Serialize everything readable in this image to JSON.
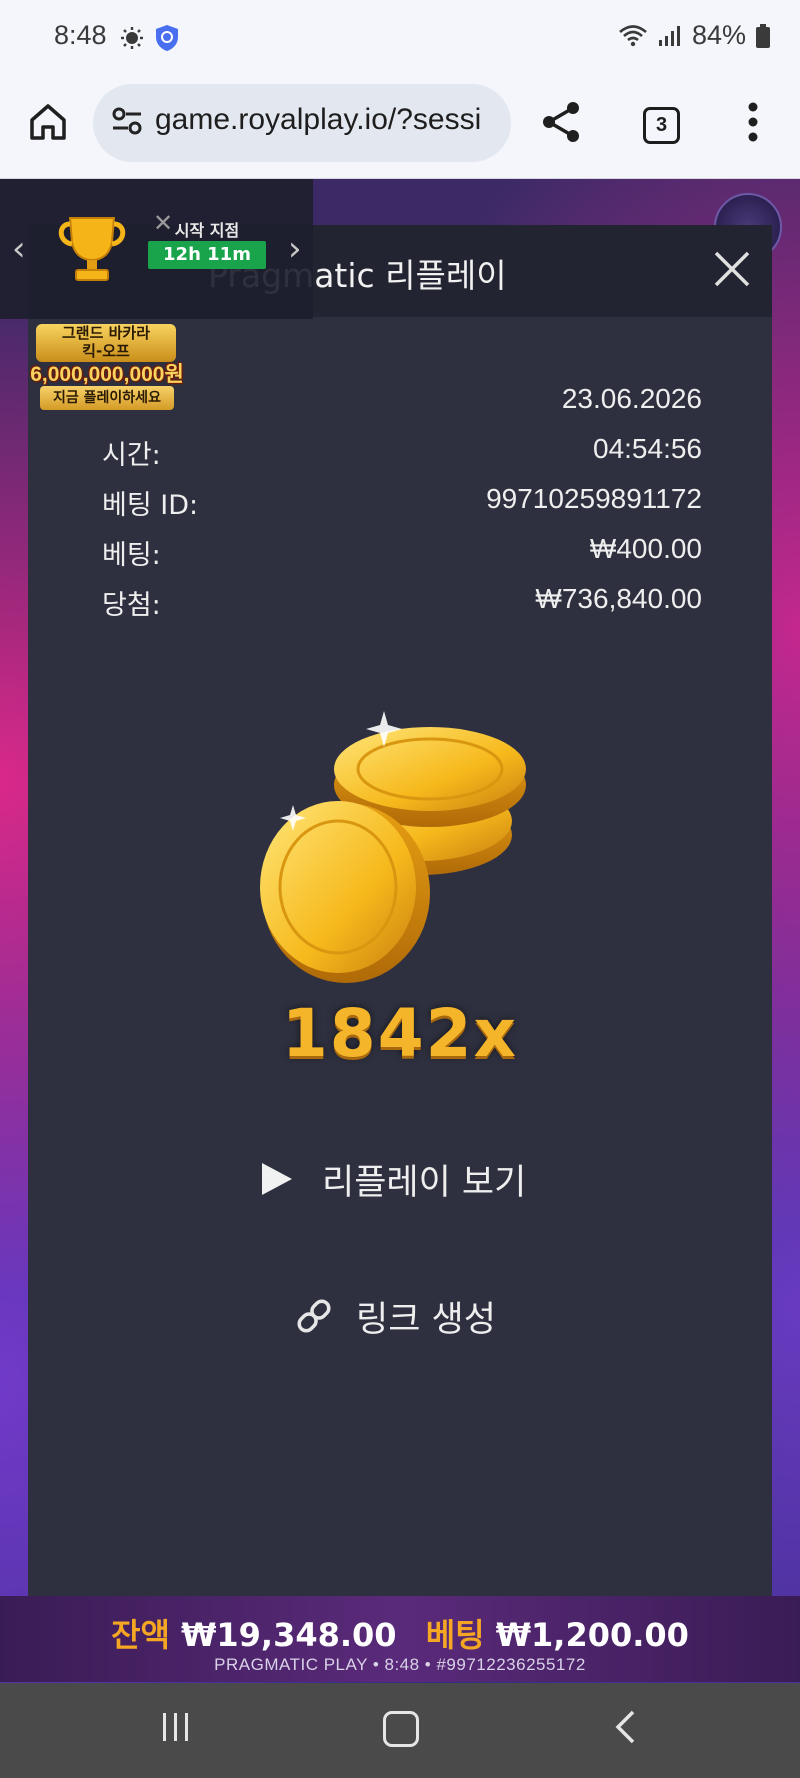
{
  "status_bar": {
    "time": "8:48",
    "battery": "84%"
  },
  "browser": {
    "url": "game.royalplay.io/?sessi",
    "tab_count": "3"
  },
  "promo": {
    "start_label": "시작 지점",
    "timer": "12h 11m",
    "banner_line1": "그랜드 바카라",
    "banner_line2": "킥-오프",
    "amount": "6,000,000,000원",
    "play_now": "지금 플레이하세요"
  },
  "modal": {
    "title": "Pragmatic 리플레이",
    "rows": [
      {
        "label": "",
        "value": "23.06.2026"
      },
      {
        "label": "시간:",
        "value": "04:54:56"
      },
      {
        "label": "베팅 ID:",
        "value": "99710259891172"
      },
      {
        "label": "베팅:",
        "value": "₩400.00"
      },
      {
        "label": "당첨:",
        "value": "₩736,840.00"
      }
    ],
    "multiplier": "1842x",
    "replay_label": "리플레이 보기",
    "link_label": "링크 생성"
  },
  "game_footer": {
    "balance_label": "잔액",
    "balance_value": "₩19,348.00",
    "bet_label": "베팅",
    "bet_value": "₩1,200.00",
    "provider_line": "PRAGMATIC PLAY • 8:48 • #99712236255172"
  },
  "colors": {
    "modal_bg": "#2e303f",
    "modal_header_bg": "#222431",
    "accent_gold": "#f5a623",
    "timer_green": "#19a44b"
  },
  "icons": [
    "settings-gear-icon",
    "shield-icon",
    "wifi-icon",
    "signal-icon",
    "battery-icon",
    "home-icon",
    "tune-icon",
    "share-icon",
    "more-vert-icon",
    "close-icon",
    "play-icon",
    "link-icon",
    "trophy-icon",
    "recent-apps-icon",
    "nav-home-icon",
    "back-icon"
  ]
}
